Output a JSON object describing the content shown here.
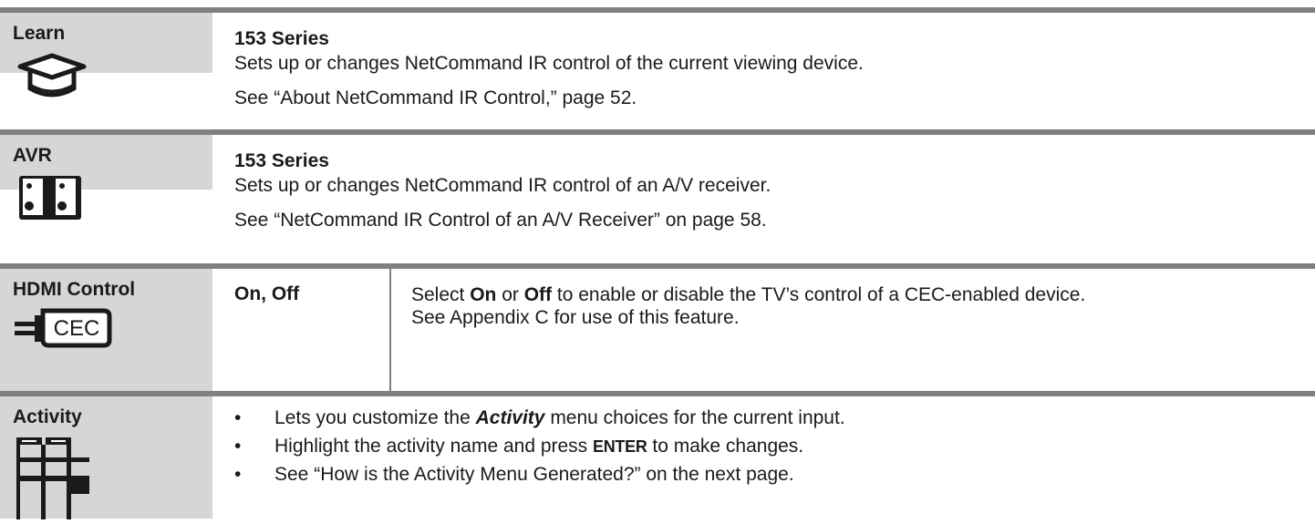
{
  "rows": {
    "learn": {
      "label": "Learn",
      "icon": "graduation-cap-icon",
      "series": "153 Series",
      "line1": "Sets up or changes NetCommand IR control of the current viewing device.",
      "line2": "See “About NetCommand IR Control,” page 52."
    },
    "avr": {
      "label": "AVR",
      "icon": "speakers-icon",
      "series": "153 Series",
      "line1": "Sets up or changes NetCommand IR control of an A/V receiver.",
      "line2": "See “NetCommand IR Control of an A/V Receiver” on page 58."
    },
    "hdmi": {
      "label": "HDMI Control",
      "icon": "cec-plug-icon",
      "icon_text": "CEC",
      "options": "On, Off",
      "desc_a": "Select ",
      "desc_on": "On",
      "desc_b": " or ",
      "desc_off": "Off",
      "desc_c": " to enable or disable the TV’s control of a CEC-enabled device.",
      "desc_line2": "See Appendix C for use of this feature."
    },
    "activity": {
      "label": "Activity",
      "icon": "grid-table-icon",
      "b1_a": "Lets you customize the ",
      "b1_em": "Activity",
      "b1_b": " menu choices for the current input.",
      "b2_a": "Highlight the activity name and press ",
      "b2_key": "ENTER",
      "b2_b": " to make changes.",
      "b3": "See “How is the Activity Menu Generated?” on the next page."
    }
  },
  "colors": {
    "rule": "#808080",
    "label_bg": "#d6d6d6",
    "text": "#1a1a1a"
  }
}
